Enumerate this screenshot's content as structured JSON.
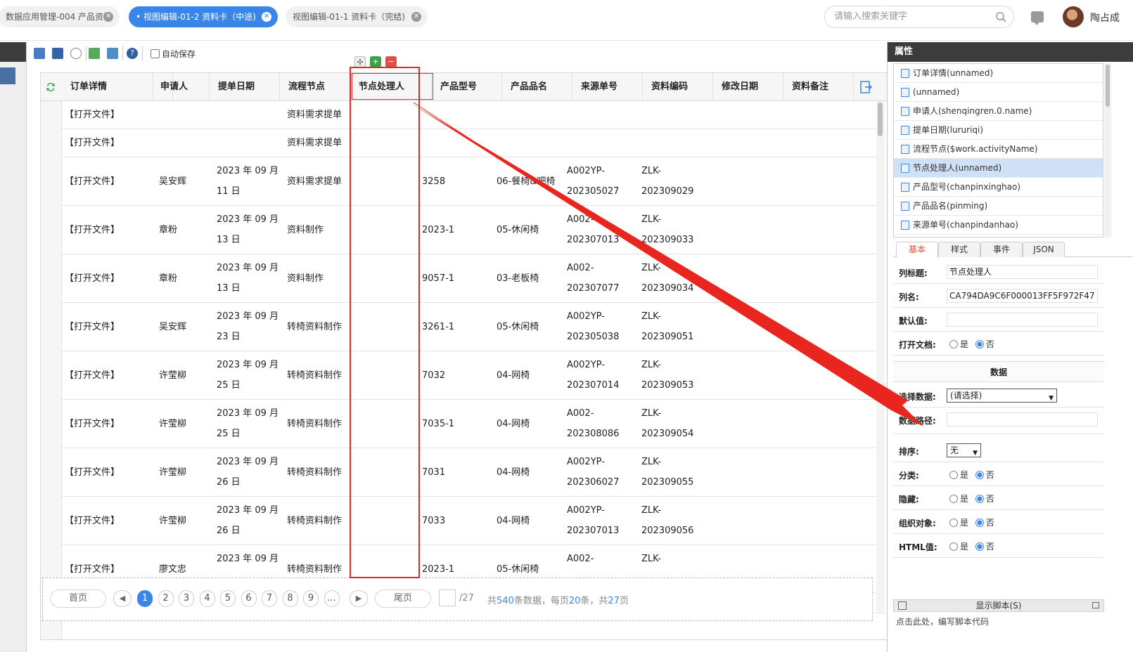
{
  "tabs": [
    {
      "label": "数据应用管理-004 产品资料",
      "active": false
    },
    {
      "label": "• 视图编辑-01-2 资料卡（中途)",
      "active": true
    },
    {
      "label": "视图编辑-01-1 资料卡（完结)",
      "active": false
    }
  ],
  "search": {
    "placeholder": "请输入搜索关键字",
    "icon": "search-icon"
  },
  "user": {
    "name": "陶占成"
  },
  "toolbar": {
    "autosave_label": "自动保存",
    "icons": [
      "save-icon",
      "save-as-icon",
      "preview-icon",
      "import-icon",
      "export-icon",
      "help-icon"
    ]
  },
  "grid": {
    "columns": [
      "订单详情",
      "",
      "申请人",
      "提单日期",
      "流程节点",
      "节点处理人",
      "产品型号",
      "产品品名",
      "来源单号",
      "资料编码",
      "修改日期",
      "资料备注"
    ],
    "rows": [
      {
        "open": "【打开文件】",
        "applicant": "",
        "date1": "",
        "date2": "",
        "node": "资料需求提单",
        "model": "",
        "name": "",
        "src1": "",
        "src2": "",
        "code1": "",
        "code2": ""
      },
      {
        "open": "【打开文件】",
        "applicant": "",
        "date1": "",
        "date2": "",
        "node": "资料需求提单",
        "model": "",
        "name": "",
        "src1": "",
        "src2": "",
        "code1": "",
        "code2": ""
      },
      {
        "open": "【打开文件】",
        "applicant": "吴安辉",
        "date1": "2023 年 09 月",
        "date2": "11 日",
        "node": "资料需求提单",
        "model": "3258",
        "name": "06-餐椅&吧椅",
        "src1": "A002YP-",
        "src2": "202305027",
        "code1": "ZLK-",
        "code2": "202309029"
      },
      {
        "open": "【打开文件】",
        "applicant": "章粉",
        "date1": "2023 年 09 月",
        "date2": "13 日",
        "node": "资料制作",
        "model": "2023-1",
        "name": "05-休闲椅",
        "src1": "A002-",
        "src2": "202307013",
        "code1": "ZLK-",
        "code2": "202309033"
      },
      {
        "open": "【打开文件】",
        "applicant": "章粉",
        "date1": "2023 年 09 月",
        "date2": "13 日",
        "node": "资料制作",
        "model": "9057-1",
        "name": "03-老板椅",
        "src1": "A002-",
        "src2": "202307077",
        "code1": "ZLK-",
        "code2": "202309034"
      },
      {
        "open": "【打开文件】",
        "applicant": "吴安辉",
        "date1": "2023 年 09 月",
        "date2": "23 日",
        "node": "转椅资料制作",
        "model": "3261-1",
        "name": "05-休闲椅",
        "src1": "A002YP-",
        "src2": "202305038",
        "code1": "ZLK-",
        "code2": "202309051"
      },
      {
        "open": "【打开文件】",
        "applicant": "许莹柳",
        "date1": "2023 年 09 月",
        "date2": "25 日",
        "node": "转椅资料制作",
        "model": "7032",
        "name": "04-网椅",
        "src1": "A002YP-",
        "src2": "202307014",
        "code1": "ZLK-",
        "code2": "202309053"
      },
      {
        "open": "【打开文件】",
        "applicant": "许莹柳",
        "date1": "2023 年 09 月",
        "date2": "25 日",
        "node": "转椅资料制作",
        "model": "7035-1",
        "name": "04-网椅",
        "src1": "A002-",
        "src2": "202308086",
        "code1": "ZLK-",
        "code2": "202309054"
      },
      {
        "open": "【打开文件】",
        "applicant": "许莹柳",
        "date1": "2023 年 09 月",
        "date2": "26 日",
        "node": "转椅资料制作",
        "model": "7031",
        "name": "04-网椅",
        "src1": "A002YP-",
        "src2": "202306027",
        "code1": "ZLK-",
        "code2": "202309055"
      },
      {
        "open": "【打开文件】",
        "applicant": "许莹柳",
        "date1": "2023 年 09 月",
        "date2": "26 日",
        "node": "转椅资料制作",
        "model": "7033",
        "name": "04-网椅",
        "src1": "A002YP-",
        "src2": "202307013",
        "code1": "ZLK-",
        "code2": "202309056"
      },
      {
        "open": "【打开文件】",
        "applicant": "廖文忠",
        "date1": "2023 年 09 月",
        "date2": "",
        "node": "转椅资料制作",
        "model": "2023-1",
        "name": "05-休闲椅",
        "src1": "A002-",
        "src2": "",
        "code1": "ZLK-",
        "code2": ""
      }
    ]
  },
  "pager": {
    "first": "首页",
    "last": "尾页",
    "pages": [
      "1",
      "2",
      "3",
      "4",
      "5",
      "6",
      "7",
      "8",
      "9",
      "..."
    ],
    "current": "1",
    "total_pages_text": "/27",
    "summary_pre": "共",
    "total_records": "540",
    "summary_mid1": "条数据，每页",
    "page_size": "20",
    "summary_mid2": "条，共",
    "total_pages": "27",
    "summary_end": "页"
  },
  "properties": {
    "title": "属性",
    "items": [
      "订单详情(unnamed)",
      "(unnamed)",
      "申请人(shenqingren.0.name)",
      "提单日期(lururiqi)",
      "流程节点($work.activityName)",
      "节点处理人(unnamed)",
      "产品型号(chanpinxinghao)",
      "产品品名(pinming)",
      "来源单号(chanpindanhao)"
    ],
    "selected_index": 5,
    "tabs": [
      "基本",
      "样式",
      "事件",
      "JSON"
    ],
    "active_tab": "基本",
    "form": {
      "col_title_label": "列标题:",
      "col_title_value": "节点处理人",
      "col_name_label": "列名:",
      "col_name_value": "CA794DA9C6F000013FF5F972F47",
      "default_label": "默认值:",
      "default_value": "",
      "open_doc_label": "打开文档:",
      "yes": "是",
      "no": "否",
      "data_section": "数据",
      "select_data_label": "选择数据:",
      "select_data_value": "(请选择)",
      "data_path_label": "数据路径:",
      "data_path_value": "",
      "sort_label": "排序:",
      "sort_value": "无",
      "category_label": "分类:",
      "hidden_label": "隐藏:",
      "org_label": "组织对象:",
      "html_label": "HTML值:"
    },
    "script_bar": "显示脚本(S)",
    "script_hint": "点击此处，编写脚本代码"
  },
  "annotation_color": "#e8261f",
  "accent_color": "#3a86e8"
}
